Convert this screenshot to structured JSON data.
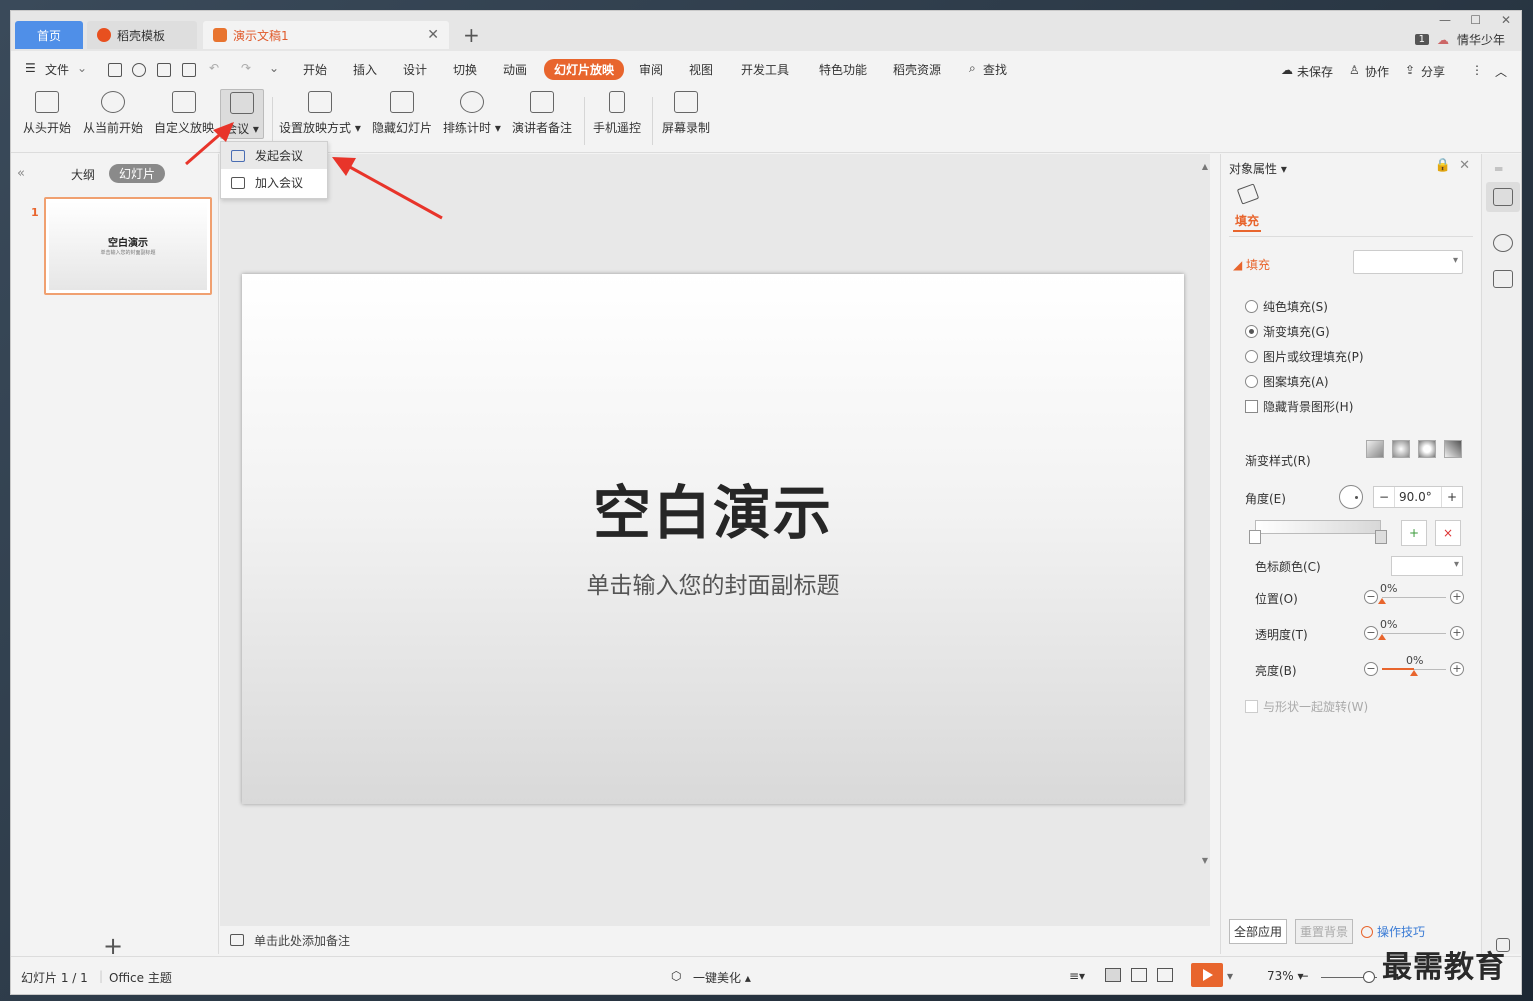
{
  "tabs": [
    {
      "label": "首页"
    },
    {
      "label": "稻壳模板"
    },
    {
      "label": "演示文稿1"
    }
  ],
  "titlebar": {
    "badge": "1",
    "username": "情华少年"
  },
  "menu": {
    "file": "文件",
    "items": [
      "开始",
      "插入",
      "设计",
      "切换",
      "动画",
      "幻灯片放映",
      "审阅",
      "视图",
      "开发工具",
      "特色功能",
      "稻壳资源"
    ],
    "active": "幻灯片放映",
    "search": "查找",
    "unsaved": "未保存",
    "collab": "协作",
    "share": "分享"
  },
  "ribbon": {
    "from_start": "从头开始",
    "from_current": "从当前开始",
    "custom_show": "自定义放映",
    "meeting": "会议",
    "setup_show": "设置放映方式",
    "hide_slide": "隐藏幻灯片",
    "rehearse": "排练计时",
    "presenter_notes": "演讲者备注",
    "phone_remote": "手机遥控",
    "screen_record": "屏幕录制"
  },
  "dropdown": {
    "start_meeting": "发起会议",
    "join_meeting": "加入会议"
  },
  "leftpanel": {
    "outline_tab": "大纲",
    "slides_tab": "幻灯片",
    "slide_number": "1",
    "thumb_title": "空白演示",
    "thumb_sub": "单击输入您的封面副标题"
  },
  "slide": {
    "title": "空白演示",
    "subtitle": "单击输入您的封面副标题"
  },
  "notes": {
    "placeholder": "单击此处添加备注"
  },
  "props": {
    "header": "对象属性",
    "fill_tab": "填充",
    "fill_section": "填充",
    "radios": [
      "纯色填充(S)",
      "渐变填充(G)",
      "图片或纹理填充(P)",
      "图案填充(A)"
    ],
    "selected_radio": "渐变填充(G)",
    "hide_bg": "隐藏背景图形(H)",
    "gradient_style": "渐变样式(R)",
    "angle_label": "角度(E)",
    "angle_value": "90.0°",
    "stop_color": "色标颜色(C)",
    "position_label": "位置(O)",
    "position_value": "0%",
    "transparency_label": "透明度(T)",
    "transparency_value": "0%",
    "brightness_label": "亮度(B)",
    "brightness_value": "0%",
    "brightness_level": 0.5,
    "rotate_with_shape": "与形状一起旋转(W)",
    "apply_all": "全部应用",
    "reset_bg": "重置背景",
    "tips": "操作技巧"
  },
  "statusbar": {
    "slide_count": "幻灯片 1 / 1",
    "theme": "Office 主题",
    "beautify": "一键美化",
    "zoom": "73%"
  },
  "watermark": "最需教育",
  "colors": {
    "accent": "#e8652d",
    "home_tab": "#4f8fe8",
    "arrow": "#e8342a"
  }
}
